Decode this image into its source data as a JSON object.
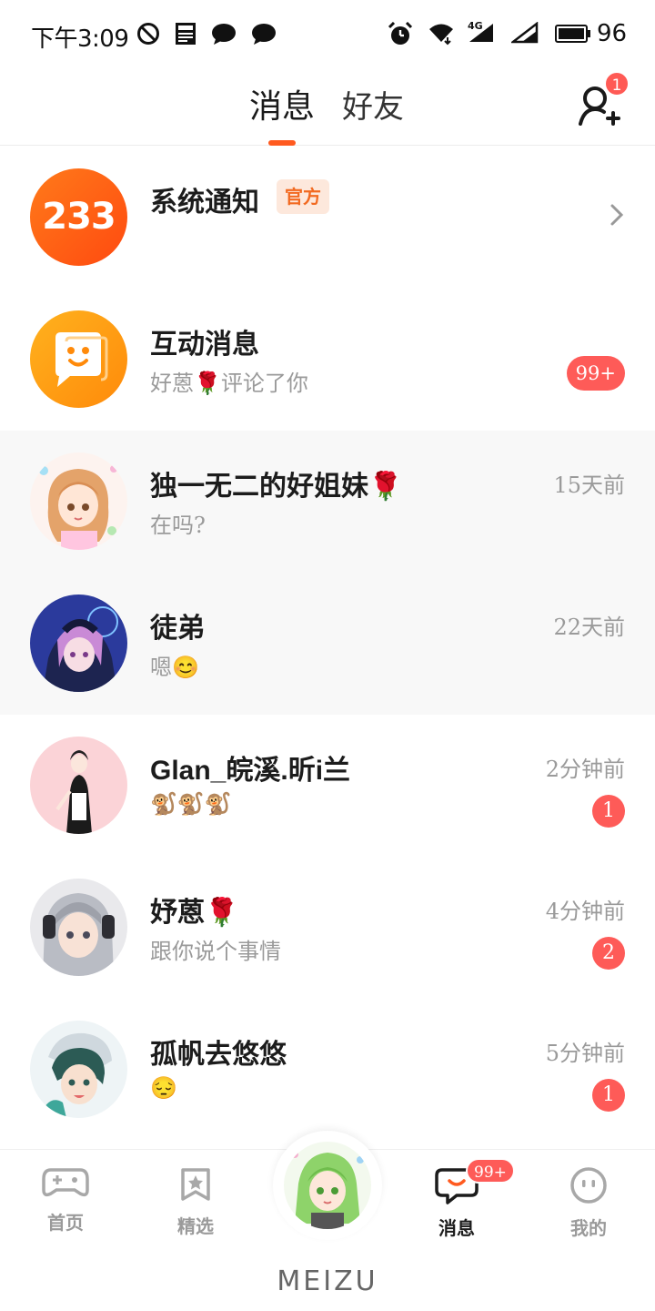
{
  "status_bar": {
    "time": "下午3:09",
    "battery": "96",
    "network": "4G",
    "icons": [
      "do-not-disturb-icon",
      "news-icon",
      "chat-icon",
      "chat-icon",
      "alarm-icon",
      "wifi-icon",
      "signal-icon",
      "signal-icon",
      "battery-icon"
    ]
  },
  "header": {
    "tabs": [
      {
        "label": "消息",
        "active": true
      },
      {
        "label": "好友",
        "active": false
      }
    ],
    "add_friend_badge": "1"
  },
  "system": {
    "logo_text": "233",
    "name": "系统通知",
    "tag": "官方"
  },
  "interaction": {
    "name": "互动消息",
    "preview": "好蒽🌹评论了你",
    "badge": "99+"
  },
  "conversations": [
    {
      "name": "独一无二的好姐妹🌹",
      "preview": "在吗?",
      "time": "15天前",
      "unread": null,
      "highlight": true
    },
    {
      "name": "徒弟",
      "preview": "嗯😊",
      "time": "22天前",
      "unread": null,
      "highlight": true
    },
    {
      "name": "Glan_皖溪.昕i兰",
      "preview": "🐒🐒🐒",
      "time": "2分钟前",
      "unread": "1",
      "highlight": false
    },
    {
      "name": "妤蒽🌹",
      "preview": "跟你说个事情",
      "time": "4分钟前",
      "unread": "2",
      "highlight": false
    },
    {
      "name": "孤帆去悠悠",
      "preview": "😔",
      "time": "5分钟前",
      "unread": "1",
      "highlight": false
    }
  ],
  "bottom_nav": {
    "items": [
      {
        "label": "首页",
        "icon": "gamepad-icon"
      },
      {
        "label": "精选",
        "icon": "star-bookmark-icon"
      },
      {
        "label": "消息",
        "icon": "message-icon",
        "active": true,
        "badge": "99+"
      },
      {
        "label": "我的",
        "icon": "face-icon"
      }
    ]
  },
  "device_brand": "MEIZU",
  "colors": {
    "accent": "#ff5a1f",
    "badge": "#fe5b58",
    "official_tag_bg": "#fde8dc",
    "official_tag_text": "#f26a21"
  }
}
